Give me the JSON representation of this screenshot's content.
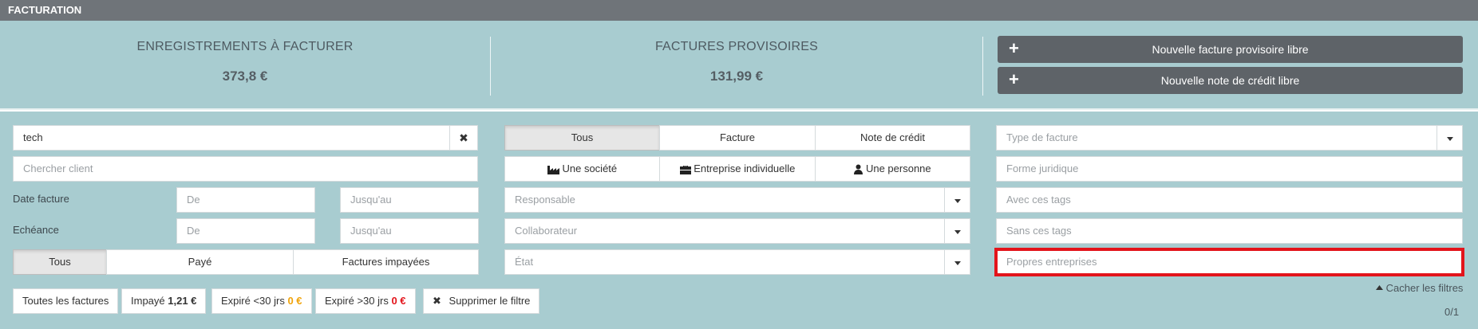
{
  "title": "FACTURATION",
  "stats": {
    "to_invoice_label": "ENREGISTREMENTS À FACTURER",
    "to_invoice_value": "373,8 €",
    "provisional_label": "FACTURES PROVISOIRES",
    "provisional_value": "131,99 €"
  },
  "actions": {
    "new_provisional": "Nouvelle facture provisoire libre",
    "new_credit": "Nouvelle note de crédit libre"
  },
  "search": {
    "value": "tech",
    "client_placeholder": "Chercher client"
  },
  "dates": {
    "invoice_date_label": "Date facture",
    "due_label": "Echéance",
    "from_placeholder": "De",
    "to_placeholder": "Jusqu'au"
  },
  "payment_filter": [
    "Tous",
    "Payé",
    "Factures impayées"
  ],
  "type_filter": [
    "Tous",
    "Facture",
    "Note de crédit"
  ],
  "entity_filter": [
    "Une société",
    "Entreprise individuelle",
    "Une personne"
  ],
  "selects_mid": {
    "responsible": "Responsable",
    "collaborator": "Collaborateur",
    "state": "État"
  },
  "selects_right": {
    "invoice_type": "Type de facture",
    "legal_form": "Forme juridique",
    "with_tags": "Avec ces tags",
    "without_tags": "Sans ces tags",
    "own_companies": "Propres entreprises"
  },
  "chips": {
    "all": "Toutes les factures",
    "unpaid_label": "Impayé",
    "unpaid_value": "1,21 €",
    "expired_lt30_label": "Expiré <30 jrs",
    "expired_lt30_value": "0 €",
    "expired_gt30_label": "Expiré >30 jrs",
    "expired_gt30_value": "0 €",
    "clear": "Supprimer le filtre"
  },
  "colors": {
    "orange": "#f0a30a",
    "red": "#e3141b",
    "panel": "#a8ccd0",
    "titlebar": "#6f7479"
  },
  "hide_filters": "Cacher les filtres",
  "pagination": "0/1"
}
